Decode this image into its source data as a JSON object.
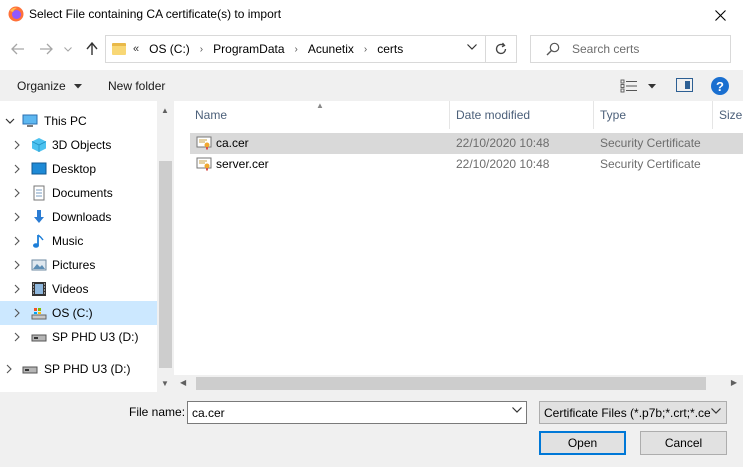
{
  "window": {
    "title": "Select File containing CA certificate(s) to import"
  },
  "address": {
    "overflow": "«",
    "crumbs": [
      "OS (C:)",
      "ProgramData",
      "Acunetix",
      "certs"
    ]
  },
  "search": {
    "placeholder": "Search certs"
  },
  "toolbar": {
    "organize_label": "Organize",
    "new_folder_label": "New folder"
  },
  "nav_tree": [
    {
      "label": "This PC",
      "icon": "pc-icon",
      "expanded": true
    },
    {
      "label": "3D Objects",
      "icon": "cube-icon"
    },
    {
      "label": "Desktop",
      "icon": "desktop-icon"
    },
    {
      "label": "Documents",
      "icon": "document-icon"
    },
    {
      "label": "Downloads",
      "icon": "download-icon"
    },
    {
      "label": "Music",
      "icon": "music-icon"
    },
    {
      "label": "Pictures",
      "icon": "pictures-icon"
    },
    {
      "label": "Videos",
      "icon": "video-icon"
    },
    {
      "label": "OS (C:)",
      "icon": "drive-icon",
      "selected": true
    },
    {
      "label": "SP PHD U3 (D:)",
      "icon": "usb-drive-icon"
    },
    {
      "label": "SP PHD U3 (D:)",
      "icon": "usb-drive-icon"
    }
  ],
  "columns": {
    "name": "Name",
    "date": "Date modified",
    "type": "Type",
    "size": "Size"
  },
  "files": [
    {
      "name": "ca.cer",
      "date": "22/10/2020 10:48",
      "type": "Security Certificate",
      "selected": true
    },
    {
      "name": "server.cer",
      "date": "22/10/2020 10:48",
      "type": "Security Certificate"
    }
  ],
  "footer": {
    "filename_label": "File name:",
    "filename_value": "ca.cer",
    "filter_value": "Certificate Files (*.p7b;*.crt;*.ce",
    "open_label": "Open",
    "cancel_label": "Cancel"
  },
  "colors": {
    "selection_nav": "#cce8ff",
    "selection_row": "#d9d9d9",
    "accent": "#0078d7"
  }
}
